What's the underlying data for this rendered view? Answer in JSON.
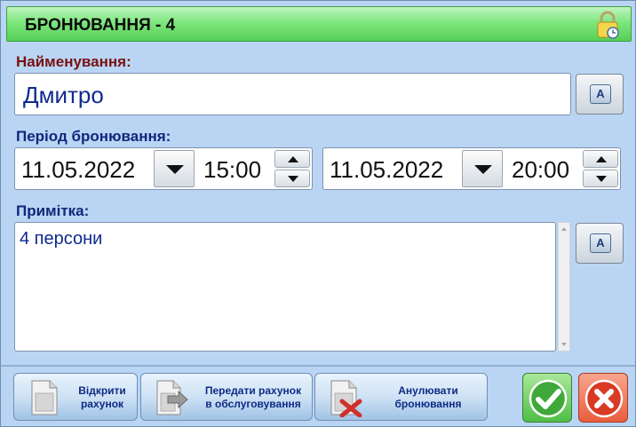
{
  "window": {
    "title": "БРОНЮВАННЯ - 4"
  },
  "form": {
    "name_label": "Найменування:",
    "name_value": "Дмитро",
    "period_label": "Період бронювання:",
    "start_date": "11.05.2022",
    "start_time": "15:00",
    "end_date": "11.05.2022",
    "end_time": "20:00",
    "note_label": "Примітка:",
    "note_value": "4 персони",
    "keyboard_key": "A"
  },
  "actions": {
    "open_bill": "Відкрити\nрахунок",
    "transfer_bill": "Передати рахунок\nв обслуговування",
    "cancel_booking": "Анулювати\nбронювання"
  },
  "colors": {
    "title_bar": "#7ee67e",
    "window_bg": "#b9d5f3",
    "name_label": "#7a1111",
    "section_label": "#10287a",
    "ok": "#4fbf47",
    "cancel": "#ea5d3e"
  },
  "icons": {
    "title": "lock-clock-icon",
    "keyboard": "keyboard-key-icon",
    "open_bill": "document-icon",
    "transfer_bill": "document-arrow-icon",
    "cancel_booking": "document-cross-icon",
    "ok": "check-icon",
    "cancel": "close-icon"
  }
}
